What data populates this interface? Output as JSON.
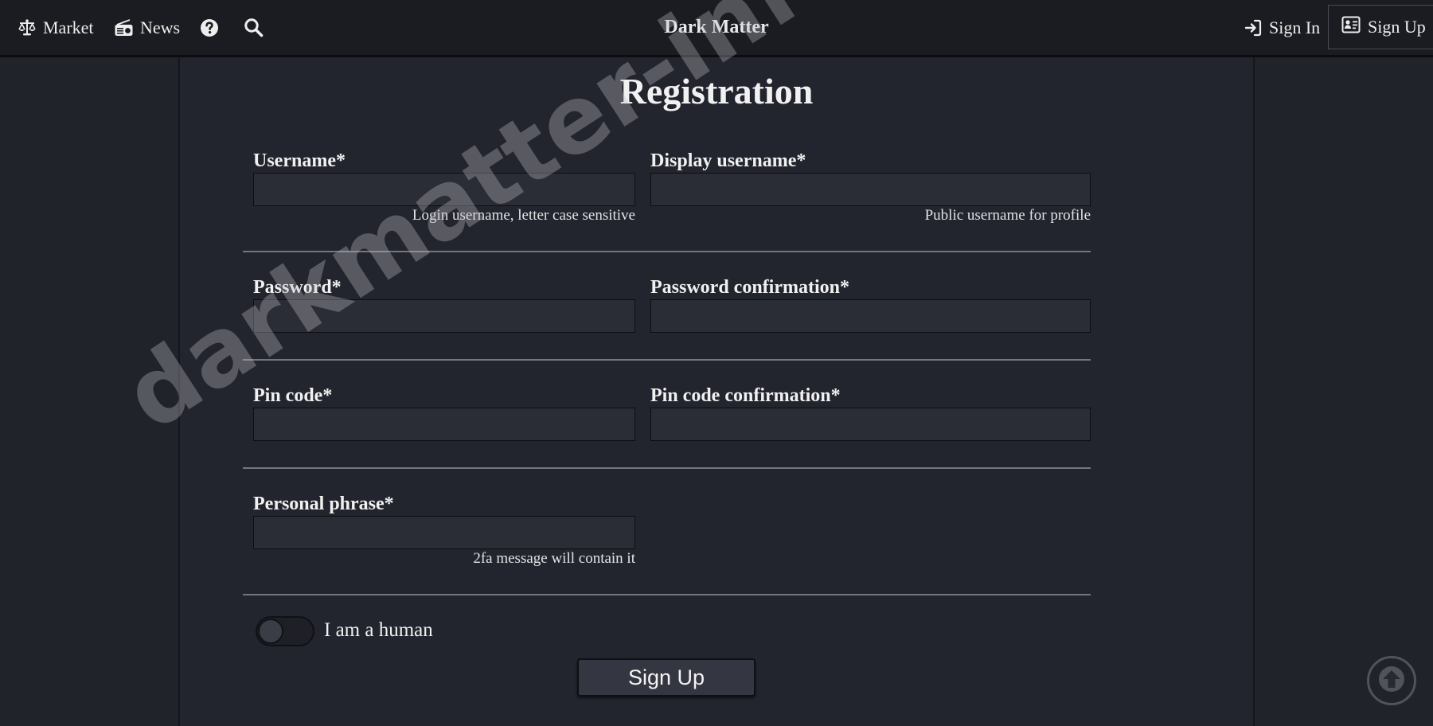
{
  "nav": {
    "market_label": "Market",
    "news_label": "News",
    "help_icon": "question-circle-icon",
    "search_icon": "search-icon",
    "brand": "Dark Matter",
    "signin_label": "Sign In",
    "signup_label": "Sign Up"
  },
  "form": {
    "title": "Registration",
    "username": {
      "label": "Username*",
      "hint": "Login username, letter case sensitive",
      "value": ""
    },
    "display_username": {
      "label": "Display username*",
      "hint": "Public username for profile",
      "value": ""
    },
    "password": {
      "label": "Password*",
      "value": ""
    },
    "password_confirmation": {
      "label": "Password confirmation*",
      "value": ""
    },
    "pin_code": {
      "label": "Pin code*",
      "value": ""
    },
    "pin_code_confirmation": {
      "label": "Pin code confirmation*",
      "value": ""
    },
    "personal_phrase": {
      "label": "Personal phrase*",
      "hint": "2fa message will contain it",
      "value": ""
    },
    "human_toggle": {
      "label": "I am a human",
      "checked": false
    },
    "submit_label": "Sign Up"
  },
  "watermark": "darkmatter-info.digital",
  "colors": {
    "background": "#21232b",
    "navbar": "#1b1c21",
    "panel": "#23252e",
    "input": "#2b2d36",
    "text": "#f1f1f1"
  }
}
